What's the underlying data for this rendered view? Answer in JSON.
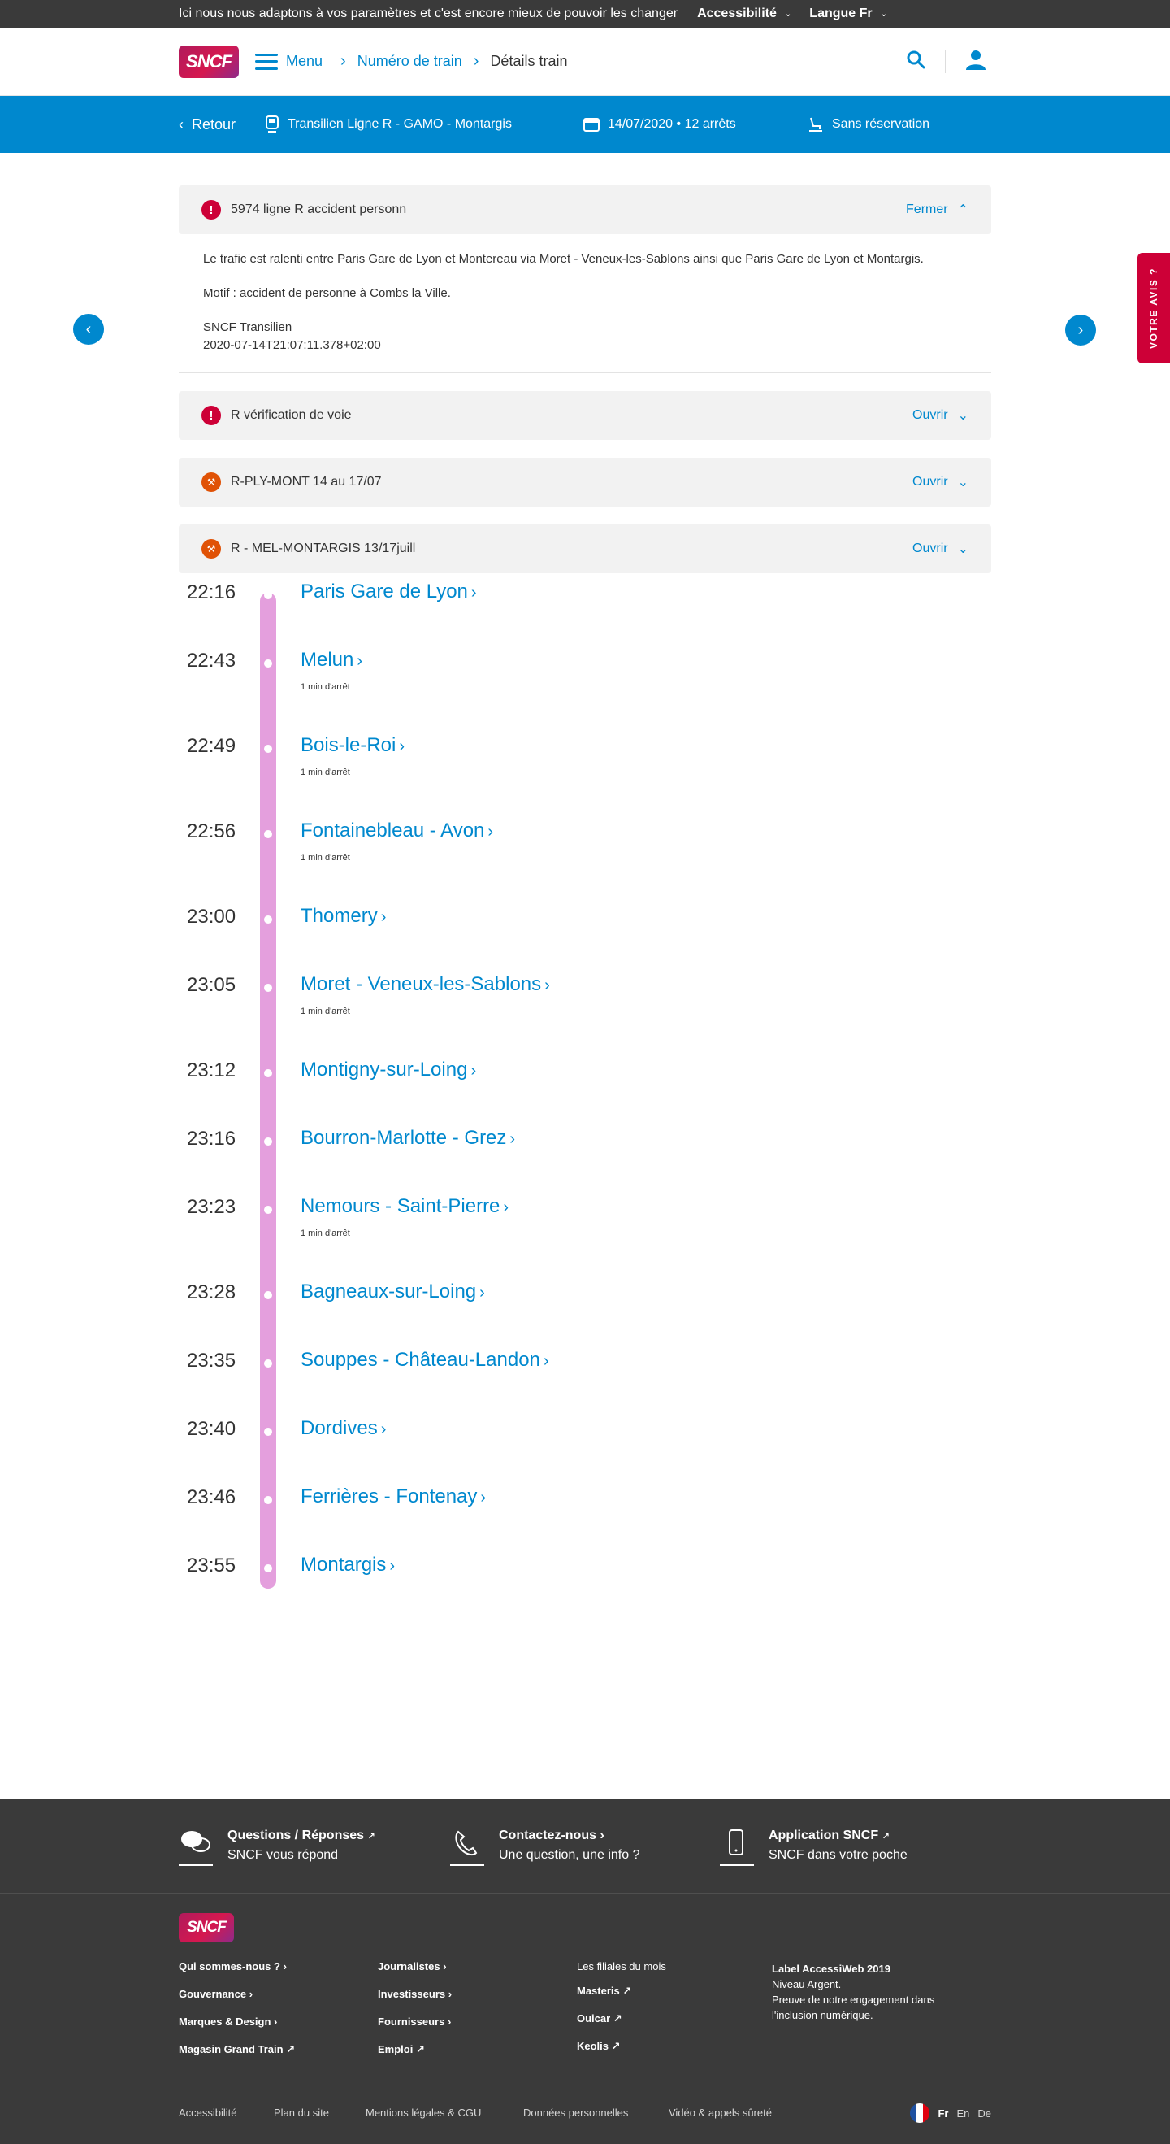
{
  "topbar": {
    "message": "Ici nous nous adaptons à vos paramètres et c'est encore mieux de pouvoir les changer",
    "accessibility": "Accessibilité",
    "language": "Langue Fr"
  },
  "header": {
    "logo": "SNCF",
    "menu": "Menu",
    "breadcrumb": [
      "Numéro de train",
      "Détails train"
    ]
  },
  "band": {
    "back": "Retour",
    "line": "Transilien Ligne R - GAMO - Montargis",
    "date": "14/07/2020 • 12 arrêts",
    "reservation": "Sans réservation"
  },
  "feedback": "VOTRE AVIS ?",
  "alerts": [
    {
      "icon": "exclamation-icon",
      "title": "5974 ligne R accident personn",
      "toggle": "Fermer",
      "expanded": true,
      "body": [
        "Le trafic est ralenti entre Paris Gare de Lyon et Montereau via Moret - Veneux-les-Sablons ainsi que Paris Gare de Lyon et Montargis.",
        "Motif : accident de personne à Combs la Ville.",
        "SNCF Transilien",
        "2020-07-14T21:07:11.378+02:00"
      ]
    },
    {
      "icon": "exclamation-icon",
      "title": "R vérification de voie",
      "toggle": "Ouvrir",
      "expanded": false
    },
    {
      "icon": "works-icon",
      "title": "R-PLY-MONT 14 au 17/07",
      "toggle": "Ouvrir",
      "expanded": false
    },
    {
      "icon": "works-icon",
      "title": "R - MEL-MONTARGIS 13/17juill",
      "toggle": "Ouvrir",
      "expanded": false
    }
  ],
  "stops": [
    {
      "time": "22:16",
      "name": "Paris Gare de Lyon",
      "note": ""
    },
    {
      "time": "22:43",
      "name": "Melun",
      "note": "1 min d'arrêt"
    },
    {
      "time": "22:49",
      "name": "Bois-le-Roi",
      "note": "1 min d'arrêt"
    },
    {
      "time": "22:56",
      "name": "Fontainebleau - Avon",
      "note": "1 min d'arrêt"
    },
    {
      "time": "23:00",
      "name": "Thomery",
      "note": ""
    },
    {
      "time": "23:05",
      "name": "Moret - Veneux-les-Sablons",
      "note": "1 min d'arrêt"
    },
    {
      "time": "23:12",
      "name": "Montigny-sur-Loing",
      "note": ""
    },
    {
      "time": "23:16",
      "name": "Bourron-Marlotte - Grez",
      "note": ""
    },
    {
      "time": "23:23",
      "name": "Nemours - Saint-Pierre",
      "note": "1 min d'arrêt"
    },
    {
      "time": "23:28",
      "name": "Bagneaux-sur-Loing",
      "note": ""
    },
    {
      "time": "23:35",
      "name": "Souppes - Château-Landon",
      "note": ""
    },
    {
      "time": "23:40",
      "name": "Dordives",
      "note": ""
    },
    {
      "time": "23:46",
      "name": "Ferrières - Fontenay",
      "note": ""
    },
    {
      "time": "23:55",
      "name": "Montargis",
      "note": ""
    }
  ],
  "footer": {
    "services": [
      {
        "title": "Questions / Réponses",
        "subtitle": "SNCF vous répond",
        "icon": "chat-icon"
      },
      {
        "title": "Contactez-nous",
        "subtitle": "Une question, une info ?",
        "icon": "phone-icon"
      },
      {
        "title": "Application SNCF",
        "subtitle": "SNCF dans votre poche",
        "icon": "mobile-icon"
      }
    ],
    "logo": "SNCF",
    "col1": [
      "Qui sommes-nous ?",
      "Gouvernance",
      "Marques & Design",
      "Magasin Grand Train"
    ],
    "col2": [
      "Journalistes",
      "Investisseurs",
      "Fournisseurs",
      "Emploi"
    ],
    "col3_title": "Les filiales du mois",
    "col3": [
      "Masteris",
      "Ouicar",
      "Keolis"
    ],
    "label": {
      "title": "Label AccessiWeb 2019",
      "line1": "Niveau Argent.",
      "line2": "Preuve de notre engagement dans l'inclusion numérique."
    },
    "legal": [
      "Accessibilité",
      "Plan du site",
      "Mentions légales & CGU",
      "Données personnelles",
      "Vidéo & appels sûreté"
    ],
    "languages": [
      "Fr",
      "En",
      "De"
    ]
  },
  "colors": {
    "brand_blue": "#0088ce",
    "alert_red": "#cd0037",
    "works_orange": "#e05206",
    "rail_pink": "#e49fdd"
  }
}
